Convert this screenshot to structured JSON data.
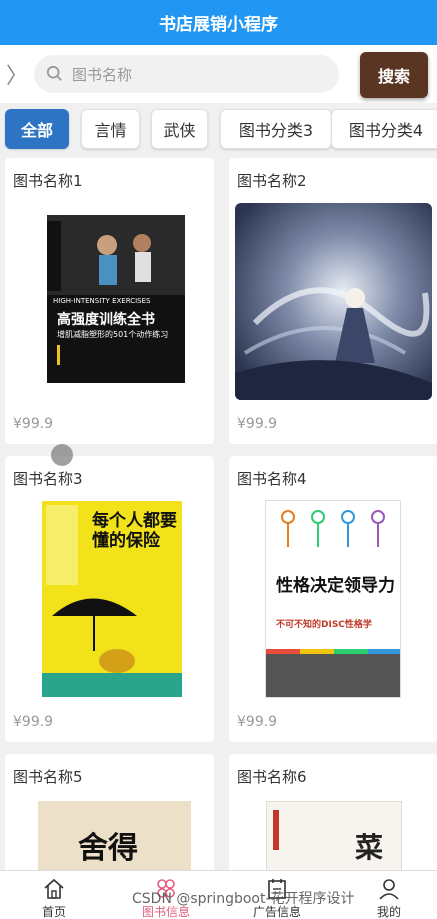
{
  "header": {
    "title": "书店展销小程序"
  },
  "search": {
    "placeholder": "图书名称",
    "button_label": "搜索"
  },
  "categories": [
    "全部",
    "言情",
    "武侠",
    "图书分类3",
    "图书分类4"
  ],
  "books": [
    {
      "name": "图书名称1",
      "price": "¥99.9",
      "cover": {
        "title": "高强度训练全书",
        "subtitle": "HIGH-INTENSITY EXERCISES",
        "tagline": "增肌减脂塑形的501个动作练习"
      }
    },
    {
      "name": "图书名称2",
      "price": "¥99.9"
    },
    {
      "name": "图书名称3",
      "price": "¥99.9",
      "cover": {
        "title": "每个人都要懂的保险"
      }
    },
    {
      "name": "图书名称4",
      "price": "¥99.9",
      "cover": {
        "title": "性格决定领导力",
        "tagline": "不可不知的DISC性格学"
      }
    },
    {
      "name": "图书名称5",
      "cover": {
        "title": "舍得"
      }
    },
    {
      "name": "图书名称6",
      "cover": {
        "title": "菜"
      }
    }
  ],
  "tabbar": [
    "首页",
    "图书信息",
    "广告信息",
    "我的"
  ],
  "watermark": "CSDN @springboot-花开程序设计",
  "colors": {
    "header": "#2196f3",
    "search_button": "#5a3521",
    "active_tab": "#2d74c4",
    "active_nav": "#e0607e"
  }
}
